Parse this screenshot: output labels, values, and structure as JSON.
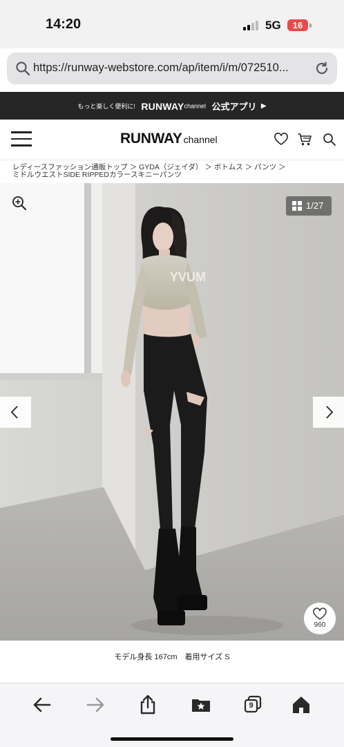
{
  "status_bar": {
    "time": "14:20",
    "network": "5G",
    "battery": "16"
  },
  "browser": {
    "url": "https://runway-webstore.com/ap/item/i/m/072510...",
    "tabs_count": "9"
  },
  "promo_banner": {
    "lead": "もっと楽しく便利に!",
    "brand": "RUNWAY",
    "brand_sub": "channel",
    "app_label": "公式アプリ",
    "arrow": "▶"
  },
  "header": {
    "logo_main": "RUNWAY",
    "logo_sub": "channel"
  },
  "breadcrumb": {
    "line1": "レディースファッション通販トップ ＞ GYDA（ジェイダ） ＞ ボトムス ＞ パンツ ＞",
    "line2": "ミドルウエストSIDE RIPPEDカラースキニーパンツ"
  },
  "gallery": {
    "counter": "1/27",
    "favorites_count": "960",
    "sweater_print": "YVUM"
  },
  "caption": "モデル身長 167cm　着用サイズ S",
  "colors": {
    "banner_bg": "#262626",
    "battery": "#e8494b",
    "toolbar_icon": "#2a2a2a",
    "toolbar_icon_disabled": "#9a9a9a"
  }
}
